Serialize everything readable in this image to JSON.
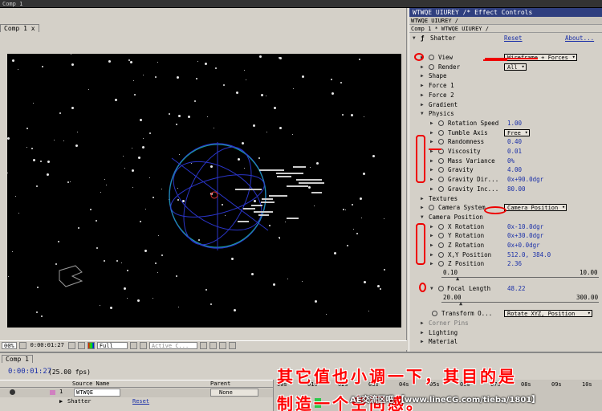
{
  "app": {
    "title": "Comp 1"
  },
  "comp": {
    "tab": "Comp 1",
    "close": "x"
  },
  "viewer_toolbar": {
    "zoom": "00%",
    "timecode": "0:00:01:27",
    "resolution": "Full",
    "view": "Active C..."
  },
  "effect_controls": {
    "window_title": "WTWQE  UIUREY  /* Effect Controls",
    "tab_label": "WTWQE  UIUREY  /",
    "breadcrumb": "Comp 1 * WTWQE  UIUREY  /",
    "effect_name": "Shatter",
    "reset": "Reset",
    "about": "About...",
    "rows": [
      {
        "label": "View",
        "value": "Wireframe + Forces",
        "kind": "select"
      },
      {
        "label": "Render",
        "value": "All",
        "kind": "select"
      },
      {
        "label": "Shape",
        "kind": "group"
      },
      {
        "label": "Force 1",
        "kind": "group"
      },
      {
        "label": "Force 2",
        "kind": "group"
      },
      {
        "label": "Gradient",
        "kind": "group"
      },
      {
        "label": "Physics",
        "kind": "group-open"
      },
      {
        "label": "Rotation Speed",
        "value": "1.00"
      },
      {
        "label": "Tumble Axis",
        "value": "Free",
        "kind": "select"
      },
      {
        "label": "Randomness",
        "value": "0.40"
      },
      {
        "label": "Viscosity",
        "value": "0.01"
      },
      {
        "label": "Mass Variance",
        "value": "0%"
      },
      {
        "label": "Gravity",
        "value": "4.00"
      },
      {
        "label": "Gravity Dir...",
        "value": "0x+90.0dgr"
      },
      {
        "label": "Gravity Inc...",
        "value": "80.00"
      },
      {
        "label": "Textures",
        "kind": "group"
      },
      {
        "label": "Camera System",
        "value": "Camera Position",
        "kind": "select"
      },
      {
        "label": "Camera Position",
        "kind": "group-open"
      },
      {
        "label": "X Rotation",
        "value": "0x-10.0dgr"
      },
      {
        "label": "Y Rotation",
        "value": "0x+30.0dgr"
      },
      {
        "label": "Z Rotation",
        "value": "0x+0.0dgr"
      },
      {
        "label": "X,Y Position",
        "value": "512.0, 384.0"
      },
      {
        "label": "Z Position",
        "value": "2.36"
      }
    ],
    "z_slider": {
      "min": "0.10",
      "max": "10.00"
    },
    "focal": {
      "label": "Focal Length",
      "value": "48.22",
      "min": "20.00",
      "max": "300.00"
    },
    "transform": {
      "label": "Transform O...",
      "value": "Rotate XYZ, Position"
    },
    "tail": [
      "Corner Pins",
      "Lighting",
      "Material"
    ]
  },
  "timeline": {
    "tab": "Comp 1",
    "timecode": "0:00:01:27",
    "fps": "(25.00 fps)",
    "columns": [
      "Source Name",
      "Parent"
    ],
    "layer_num": "1",
    "layer_name": "WTWQE",
    "parent_value": "None",
    "effect_row": "Shatter",
    "effect_reset": "Reset",
    "ruler": [
      "00s",
      "01s",
      "02s",
      "03s",
      "04s",
      "05s",
      "06s",
      "07s",
      "08s",
      "09s",
      "10s"
    ]
  },
  "overlay": {
    "line1": "其它值也小调一下，其目的是",
    "line2": "制造一个空间感。",
    "watermark": "AE交流区吧 【www.lineCG.com/tieba/1801】"
  },
  "colors": {
    "annotation": "#ff0000",
    "panel": "#d4d0c8",
    "title": "#2f3f7f",
    "value": "#1a2fa8"
  }
}
